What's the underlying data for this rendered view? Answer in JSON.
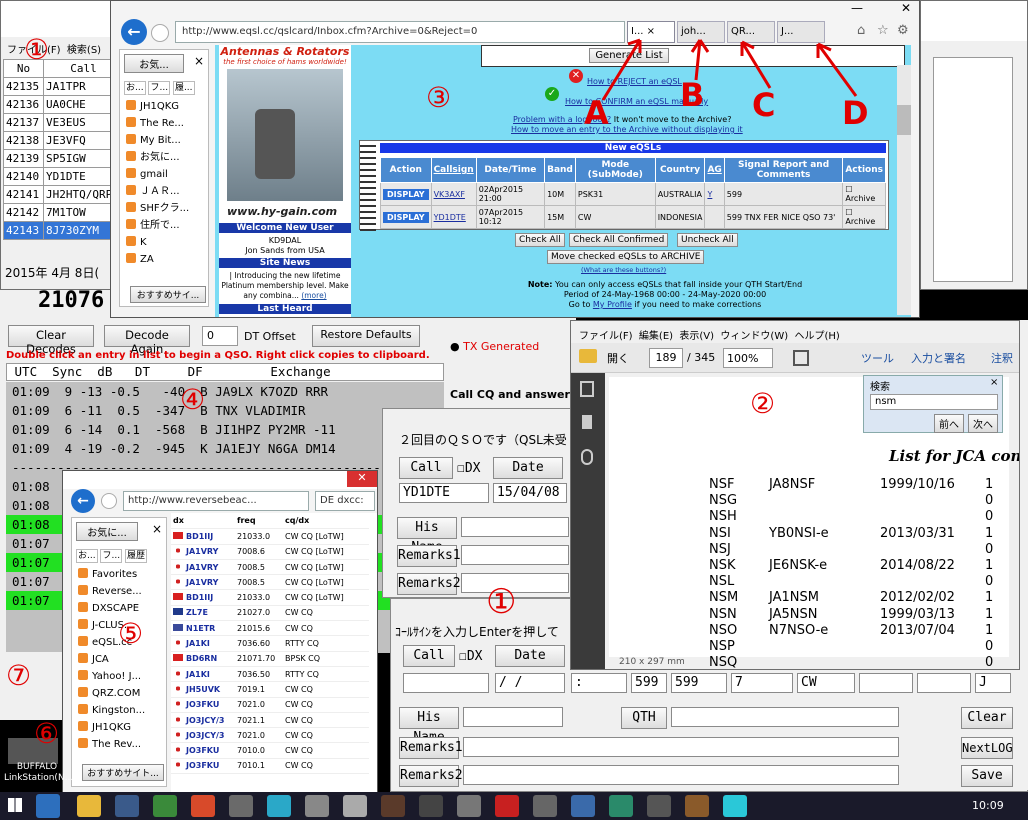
{
  "log": {
    "menu": [
      "ファイル(F)",
      "検索(S)",
      "表示"
    ],
    "headers": [
      "No",
      "Call"
    ],
    "rows": [
      [
        "42135",
        "JA1TPR"
      ],
      [
        "42136",
        "UA0CHE"
      ],
      [
        "42137",
        "VE3EUS"
      ],
      [
        "42138",
        "JE3VFQ"
      ],
      [
        "42139",
        "SP5IGW"
      ],
      [
        "42140",
        "YD1DTE"
      ],
      [
        "42141",
        "JH2HTQ/QRP"
      ],
      [
        "42142",
        "7M1TOW"
      ],
      [
        "42143",
        "8J730ZYM"
      ]
    ],
    "date": "2015年  4月  8日(",
    "big_number": "21076"
  },
  "ie1": {
    "url": "http://www.eqsl.cc/qslcard/Inbox.cfm?Archive=0&Reject=0",
    "tabs": [
      "I...",
      "joh...",
      "QR...",
      "J..."
    ],
    "fav_button": "お気...",
    "fav_tabs": [
      "お...",
      "フ...",
      "履..."
    ],
    "favs": [
      "JH1QKG",
      "The Re...",
      "My Bit...",
      "お気に...",
      "gmail",
      "ＪＡＲ...",
      "SHFクラ...",
      "住所で...",
      "K",
      "ZA"
    ],
    "fav_bottom": "おすすめサイ...",
    "ad_line1": "Antennas & Rotators",
    "ad_line2": "the first choice of hams worldwide!",
    "ad_url": "www.hy-gain.com",
    "welcome": "Welcome New User",
    "welcome_call": "KD9DAL",
    "welcome_name": "Jon Sands from USA",
    "site_news": "Site News",
    "news_text": "| Introducing the new lifetime Platinum membership level. Make any combina...",
    "news_more": "(more)",
    "last_heard": "Last Heard",
    "gen_list": "Generate List",
    "reject_link": "How to REJECT an eQSL",
    "confirm_link": "How to CONFIRM an eQSL manually",
    "problem_link": "Problem with a logbook?",
    "problem_text": "It won't move to the Archive?",
    "move_link": "How to move an entry to the Archive without displaying it",
    "table_title": "New eQSLs",
    "table_headers": [
      "Action",
      "Callsign",
      "Date/Time",
      "Band",
      "Mode (SubMode)",
      "Country",
      "AG",
      "Signal Report and Comments",
      "Actions"
    ],
    "rows": [
      {
        "action": "DISPLAY",
        "call": "VK3AXF",
        "dt": "02Apr2015 21:00",
        "band": "10M",
        "mode": "PSK31",
        "country": "AUSTRALIA",
        "ag": "Y",
        "sig": "599",
        "act": "Archive"
      },
      {
        "action": "DISPLAY",
        "call": "YD1DTE",
        "dt": "07Apr2015 10:12",
        "band": "15M",
        "mode": "CW",
        "country": "INDONESIA",
        "ag": "",
        "sig": "599 TNX FER NICE QSO 73'",
        "act": "Archive"
      }
    ],
    "buttons": [
      "Check All",
      "Check All Confirmed",
      "Uncheck All"
    ],
    "move_btn": "Move checked eQSLs to ARCHIVE",
    "why_link": "(What are these buttons?)",
    "note_bold": "Note:",
    "note": "You can only access eQSLs that fall inside your QTH Start/End Period of 24-May-1968 00:00 - 24-May-2020 00:00",
    "note2": "Go to",
    "note_link": "My Profile",
    "note3": "if you need to make corrections"
  },
  "wsjt": {
    "clear": "Clear Decodes",
    "decode": "Decode Again",
    "offset_val": "0",
    "offset_label": "DT Offset",
    "restore": "Restore Defaults",
    "hint": "Double click an entry in list to begin a QSO.  Right click copies to clipboard.",
    "tx_gen": "TX Generated",
    "callcq": "Call CQ and answer ca",
    "header": " UTC  Sync  dB   DT     DF         Exchange",
    "lines": [
      "01:09  9 -13 -0.5   -40  B JA9LX K7OZD RRR",
      "01:09  6 -11  0.5  -347  B TNX VLADIMIR",
      "01:09  6 -14  0.1  -568  B JI1HPZ PY2MR -11",
      "01:09  4 -19 -0.2  -945  K JA1EJY N6GA DM14",
      "-------------------------------------------------",
      "01:08",
      "01:08",
      "01:08",
      "01:07",
      "01:07",
      "01:07",
      "01:07"
    ]
  },
  "qso1": {
    "title": "２回目のＱＳＯです（QSL未受",
    "call_btn": "Call",
    "dx_label": "DX",
    "date_btn": "Date",
    "call_val": "YD1DTE",
    "date_val": "15/04/08",
    "hisname": "His Name",
    "remarks1": "Remarks1",
    "remarks2": "Remarks2"
  },
  "qso2": {
    "title": "ｺｰﾙｻｲﾝを入力しEnterを押して",
    "call_btn": "Call",
    "dx_label": "DX",
    "date_btn": "Date",
    "date_val": " /   /",
    "time_val": ":",
    "rst1": "599",
    "rst2": "599",
    "pwr": "7",
    "mode": "CW",
    "last": "J",
    "hisname": "His Name",
    "qth": "QTH",
    "remarks1": "Remarks1",
    "remarks2": "Remarks2",
    "clear": "Clear",
    "next": "NextLOG",
    "save": "Save"
  },
  "pdf": {
    "menu": [
      "ファイル(F)",
      "編集(E)",
      "表示(V)",
      "ウィンドウ(W)",
      "ヘルプ(H)"
    ],
    "open": "開く",
    "page": "189",
    "pages": "/ 345",
    "zoom": "100%",
    "tools": "ツール",
    "sign": "入力と署名",
    "comment": "注釈",
    "find_title": "検索",
    "find_val": "nsm",
    "prev": "前へ",
    "next": "次へ",
    "list_title": "List for JCA con",
    "size": "210 x 297 mm",
    "rows": [
      [
        "NSF",
        "JA8NSF",
        "1999/10/16",
        "1"
      ],
      [
        "NSG",
        "",
        "",
        "0"
      ],
      [
        "NSH",
        "",
        "",
        "0"
      ],
      [
        "NSI",
        "YB0NSI-e",
        "2013/03/31",
        "1"
      ],
      [
        "NSJ",
        "",
        "",
        "0"
      ],
      [
        "NSK",
        "JE6NSK-e",
        "2014/08/22",
        "1"
      ],
      [
        "NSL",
        "",
        "",
        "0"
      ],
      [
        "NSM",
        "JA1NSM",
        "2012/02/02",
        "1"
      ],
      [
        "NSN",
        "JA5NSN",
        "1999/03/13",
        "1"
      ],
      [
        "NSO",
        "N7NSO-e",
        "2013/07/04",
        "1"
      ],
      [
        "NSP",
        "",
        "",
        "0"
      ],
      [
        "NSQ",
        "",
        "",
        "0"
      ]
    ]
  },
  "ie2": {
    "url": "http://www.reversebeac...",
    "tab": "DE dxcc:",
    "fav_button": "お気に...",
    "fav_tabs": [
      "お...",
      "フ...",
      "履歴"
    ],
    "favs": [
      "Favorites",
      "Reverse...",
      "DXSCAPE",
      "J-CLUS...",
      "eQSL.cc",
      "JCA",
      "Yahoo! J...",
      "QRZ.COM",
      "Kingston...",
      "JH1QKG",
      "The Rev..."
    ],
    "fav_bottom": "おすすめサイト...",
    "headers": [
      "dx",
      "freq",
      "cq/dx"
    ],
    "rows": [
      [
        "BD1IIJ",
        "21033.0",
        "CW CQ [LoTW]",
        "cn"
      ],
      [
        "JA1VRY",
        "7008.6",
        "CW CQ [LoTW]",
        "jp"
      ],
      [
        "JA1VRY",
        "7008.5",
        "CW CQ [LoTW]",
        "jp"
      ],
      [
        "JA1VRY",
        "7008.5",
        "CW CQ [LoTW]",
        "jp"
      ],
      [
        "BD1IIJ",
        "21033.0",
        "CW CQ [LoTW]",
        "cn"
      ],
      [
        "ZL7E",
        "21027.0",
        "CW CQ",
        "nz"
      ],
      [
        "N1ETR",
        "21015.6",
        "CW CQ",
        "us"
      ],
      [
        "JA1KI",
        "7036.60",
        "RTTY CQ",
        "jp"
      ],
      [
        "BD6RN",
        "21071.70",
        "BPSK CQ",
        "cn"
      ],
      [
        "JA1KI",
        "7036.50",
        "RTTY CQ",
        "jp"
      ],
      [
        "JH5UVK",
        "7019.1",
        "CW CQ",
        "jp"
      ],
      [
        "JO3FKU",
        "7021.0",
        "CW CQ",
        "jp"
      ],
      [
        "JO3JCY/3",
        "7021.1",
        "CW CQ",
        "jp"
      ],
      [
        "JO3JCY/3",
        "7021.0",
        "CW CQ",
        "jp"
      ],
      [
        "JO3FKU",
        "7010.0",
        "CW CQ",
        "jp"
      ],
      [
        "JO3FKU",
        "7010.1",
        "CW CQ",
        "jp"
      ]
    ]
  },
  "annotations": {
    "c1": "①",
    "c2": "②",
    "c3": "③",
    "c4": "④",
    "c5": "⑤",
    "c6": "⑥",
    "c7": "⑦",
    "c1b": "①",
    "A": "A",
    "B": "B",
    "C": "C",
    "D": "D"
  },
  "desktop": {
    "icon_label1": "BUFFALO",
    "icon_label2": "LinkStation(N..."
  },
  "taskbar": {
    "time": "10:09"
  }
}
